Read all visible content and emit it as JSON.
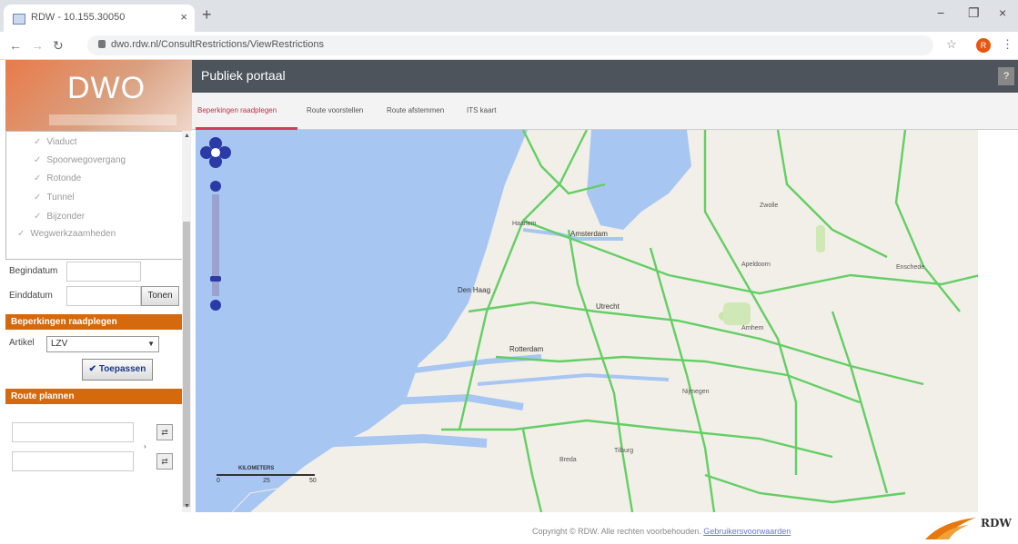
{
  "browser": {
    "tab_title": "RDW - 10.155.30050",
    "tab_close": "×",
    "new_tab": "+",
    "url": "dwo.rdw.nl/ConsultRestrictions/ViewRestrictions",
    "profile_initial": "R",
    "win_min": "−",
    "win_max": "❐",
    "win_close": "×"
  },
  "logo": {
    "text": "DWO"
  },
  "tree": {
    "items": [
      "Viaduct",
      "Spoorwegovergang",
      "Rotonde",
      "Tunnel",
      "Bijzonder",
      "Wegwerkzaamheden"
    ]
  },
  "dates": {
    "begin_label": "Begindatum",
    "end_label": "Einddatum",
    "show_button": "Tonen"
  },
  "restrictions": {
    "header": "Beperkingen raadplegen",
    "axle_label": "Artikel",
    "axle_value": "LZV",
    "apply_button": "Toepassen"
  },
  "route": {
    "header": "Route plannen"
  },
  "portal": {
    "title": "Publiek portaal",
    "help": "?"
  },
  "tabs": [
    "Beperkingen raadplegen",
    "Route voorstellen",
    "Route afstemmen",
    "ITS kaart"
  ],
  "map": {
    "cities": [
      "Amsterdam",
      "Den Haag",
      "Rotterdam",
      "Utrecht",
      "Haarlem",
      "Enschede",
      "Nijmegen",
      "Tilburg",
      "Breda",
      "Arnhem",
      "Zwolle",
      "Apeldoorn"
    ],
    "scale_label": "KILOMETERS",
    "scale_ticks": [
      "0",
      "25",
      "50"
    ]
  },
  "footer": {
    "copyright": "Copyright © RDW. Alle rechten voorbehouden.",
    "terms_link": "Gebruikersvoorwaarden"
  },
  "brand": {
    "name": "RDW"
  },
  "colors": {
    "accent": "#d4690d",
    "header": "#4d545c",
    "active_tab": "#c32f4a",
    "sea": "#a7c6f2",
    "land": "#f2efe9",
    "road": "#57c95a"
  }
}
